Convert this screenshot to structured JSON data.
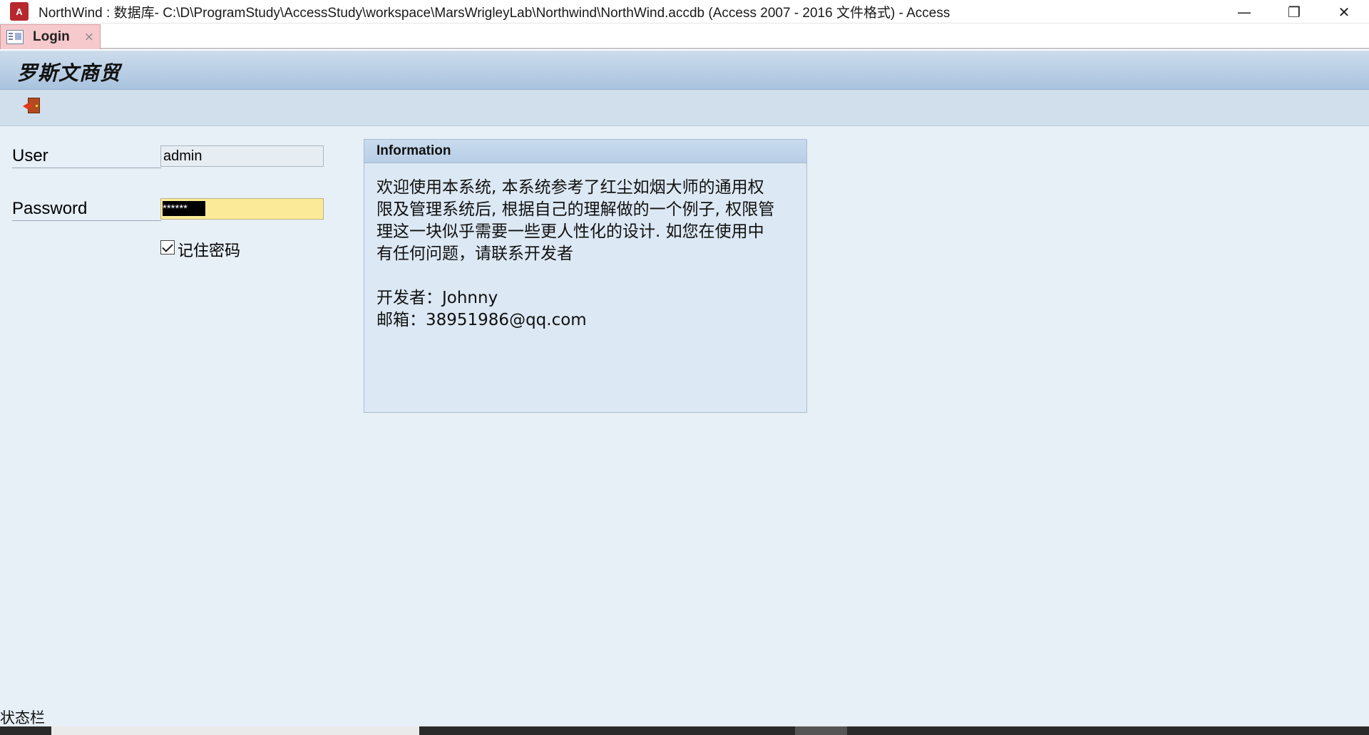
{
  "window": {
    "title": "NorthWind : 数据库- C:\\D\\ProgramStudy\\AccessStudy\\workspace\\MarsWrigleyLab\\Northwind\\NorthWind.accdb (Access 2007 - 2016 文件格式) - Access",
    "app_icon_letter": "A",
    "minimize_glyph": "—",
    "restore_glyph": "❐",
    "close_glyph": "✕"
  },
  "tabs": [
    {
      "label": "Login",
      "close_glyph": "×"
    }
  ],
  "form": {
    "brand_title": "罗斯文商贸",
    "user_label": "User",
    "user_value": "admin",
    "password_label": "Password",
    "password_masked": "******",
    "remember_label": "记住密码",
    "remember_checked": true
  },
  "info": {
    "header": "Information",
    "lines": [
      "欢迎使用本系统, 本系统参考了红尘如烟大师的通用权",
      "限及管理系统后, 根据自己的理解做的一个例子, 权限管",
      "理这一块似乎需要一些更人性化的设计. 如您在使用中",
      "有任何问题，请联系开发者"
    ],
    "developer": "开发者：Johnny",
    "email": "邮箱：38951986@qq.com"
  },
  "status_bar": {
    "text": "状态栏"
  },
  "colors": {
    "form_background": "#e7eff7",
    "header_gradient_top": "#cddcec",
    "header_gradient_bottom": "#a9c3de",
    "password_field": "#fbeb98",
    "active_tab": "#f6c9cd",
    "app_icon": "#b7282e"
  }
}
